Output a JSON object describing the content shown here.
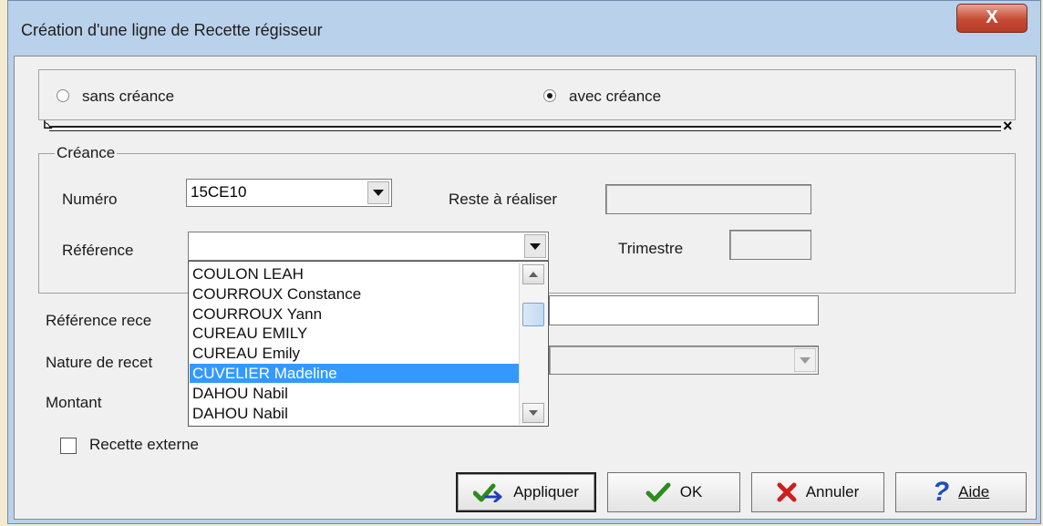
{
  "window": {
    "title": "Création d'une ligne de Recette régisseur",
    "close_label": "X"
  },
  "mode": {
    "options": [
      {
        "label": "sans créance",
        "selected": false
      },
      {
        "label": "avec créance",
        "selected": true
      }
    ],
    "splitter_left": "⊾",
    "splitter_right": "×"
  },
  "creance": {
    "group_label": "Créance",
    "numero_label": "Numéro",
    "numero_value": "15CE10",
    "reste_label": "Reste à réaliser",
    "reste_value": "",
    "reference_label": "Référence",
    "reference_value": "",
    "trimestre_label": "Trimestre",
    "trimestre_value": ""
  },
  "dropdown": {
    "items": [
      "COULON LEAH",
      "COURROUX Constance",
      "COURROUX Yann",
      "CUREAU EMILY",
      "CUREAU Emily",
      "CUVELIER Madeline",
      "DAHOU Nabil",
      "DAHOU Nabil"
    ],
    "selected_index": 5
  },
  "fields": {
    "reference_recette_label": "Référence rece",
    "reference_recette_value": "",
    "nature_label": "Nature de recet",
    "nature_value": "",
    "montant_label": "Montant"
  },
  "external": {
    "label": "Recette externe",
    "checked": false
  },
  "buttons": {
    "apply": "Appliquer",
    "ok": "OK",
    "cancel": "Annuler",
    "help": "Aide"
  },
  "colors": {
    "selection": "#3399ff",
    "title_bar": "#b9d1ea",
    "close": "#c54a35"
  }
}
